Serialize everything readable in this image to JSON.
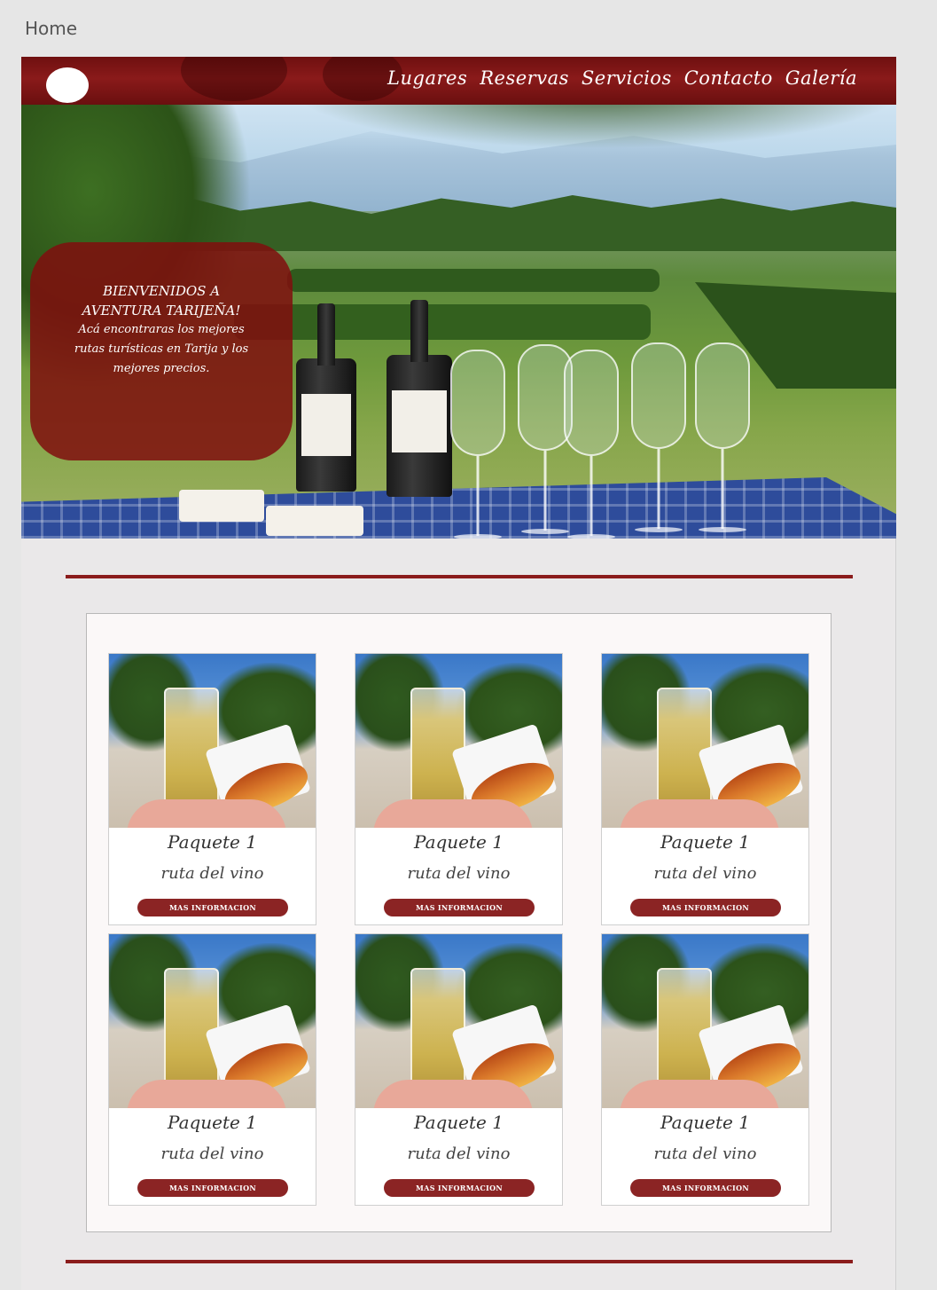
{
  "page": {
    "label": "Home"
  },
  "nav": {
    "items": [
      "Lugares",
      "Reservas",
      "Servicios",
      "Contacto",
      "Galería"
    ]
  },
  "welcome": {
    "title": "BIENVENIDOS A AVENTURA TARIJEÑA!",
    "text": "Acá encontraras los mejores rutas turísticas en Tarija y los mejores precios."
  },
  "cards": [
    {
      "title": "Paquete 1",
      "subtitle": "ruta del vino",
      "button": "MAS INFORMACION"
    },
    {
      "title": "Paquete 1",
      "subtitle": "ruta del vino",
      "button": "MAS INFORMACION"
    },
    {
      "title": "Paquete 1",
      "subtitle": "ruta del vino",
      "button": "MAS INFORMACION"
    },
    {
      "title": "Paquete 1",
      "subtitle": "ruta del vino",
      "button": "MAS INFORMACION"
    },
    {
      "title": "Paquete 1",
      "subtitle": "ruta del vino",
      "button": "MAS INFORMACION"
    },
    {
      "title": "Paquete 1",
      "subtitle": "ruta del vino",
      "button": "MAS INFORMACION"
    }
  ],
  "colors": {
    "brand_red": "#8b1c1c",
    "header_gradient": "#7a1414",
    "button": "#8b2424"
  },
  "icons": {
    "logo": "white-oval-logo"
  }
}
